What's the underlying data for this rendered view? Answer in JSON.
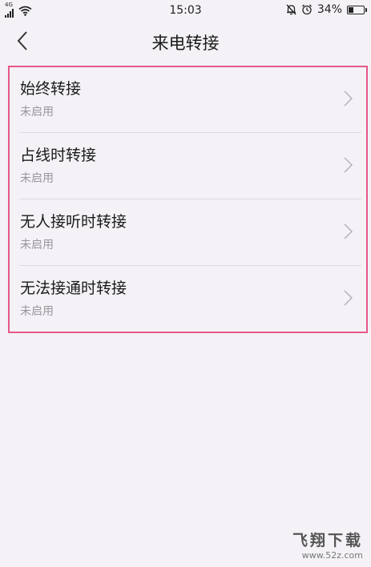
{
  "status_bar": {
    "network_label": "4G",
    "time": "15:03",
    "battery_percent_text": "34%",
    "battery_level": 0.34
  },
  "nav": {
    "title": "来电转接"
  },
  "items": [
    {
      "title": "始终转接",
      "status": "未启用"
    },
    {
      "title": "占线时转接",
      "status": "未启用"
    },
    {
      "title": "无人接听时转接",
      "status": "未启用"
    },
    {
      "title": "无法接通时转接",
      "status": "未启用"
    }
  ],
  "watermark": {
    "title": "飞翔下载",
    "url": "www.52z.com"
  },
  "colors": {
    "background": "#f4f2f6",
    "highlight_border": "#e8578a",
    "secondary_text": "#9a979c"
  },
  "icons": [
    "signal-icon",
    "wifi-icon",
    "mute-icon",
    "alarm-icon",
    "battery-icon",
    "back-arrow-icon",
    "chevron-right-icon"
  ]
}
